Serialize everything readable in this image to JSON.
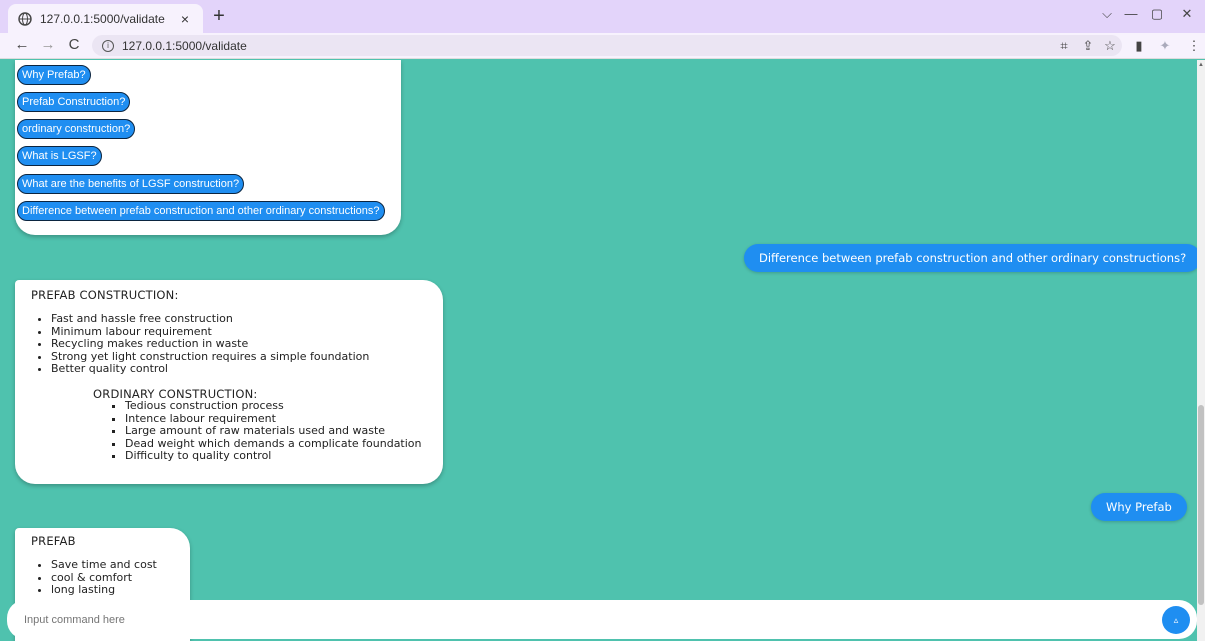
{
  "browser": {
    "tab_title": "127.0.0.1:5000/validate",
    "tab_close": "×",
    "new_tab": "+",
    "url": "127.0.0.1:5000/validate",
    "nav": {
      "back": "←",
      "forward": "→",
      "reload": "C"
    },
    "window_controls": {
      "dropdown": "⌵",
      "minimize": "—",
      "restore": "▢",
      "close": "✕"
    },
    "toolbar_icons": {
      "translate": "⌗",
      "share": "⇪",
      "bookmark": "☆",
      "sidepanel": "▮",
      "extension": "✦",
      "menu": "⋮"
    }
  },
  "chat": {
    "quick_replies": [
      "Why Prefab?",
      "Prefab Construction?",
      "ordinary construction?",
      "What is LGSF?",
      "What are the benefits of LGSF construction?",
      "Difference between prefab construction and other ordinary constructions?"
    ],
    "user_message_1": "Difference between prefab construction and other ordinary constructions?",
    "bot_answer_1": {
      "prefab_heading": "PREFAB CONSTRUCTION:",
      "prefab_points": [
        "Fast and hassle free construction",
        "Minimum labour requirement",
        "Recycling makes reduction in waste",
        "Strong yet light construction requires a simple foundation",
        "Better quality control"
      ],
      "ordinary_heading": "ORDINARY CONSTRUCTION:",
      "ordinary_points": [
        "Tedious construction process",
        "Intence labour requirement",
        "Large amount of raw materials used and waste",
        "Dead weight which demands a complicate foundation",
        "Difficulty to quality control"
      ]
    },
    "user_message_2": "Why Prefab",
    "bot_answer_2": {
      "heading": "PREFAB",
      "points": [
        "Save time and cost",
        "cool & comfort",
        "long lasting"
      ]
    }
  },
  "input": {
    "placeholder": "Input command here",
    "send_icon": "send-icon",
    "send_glyph": "▵"
  }
}
